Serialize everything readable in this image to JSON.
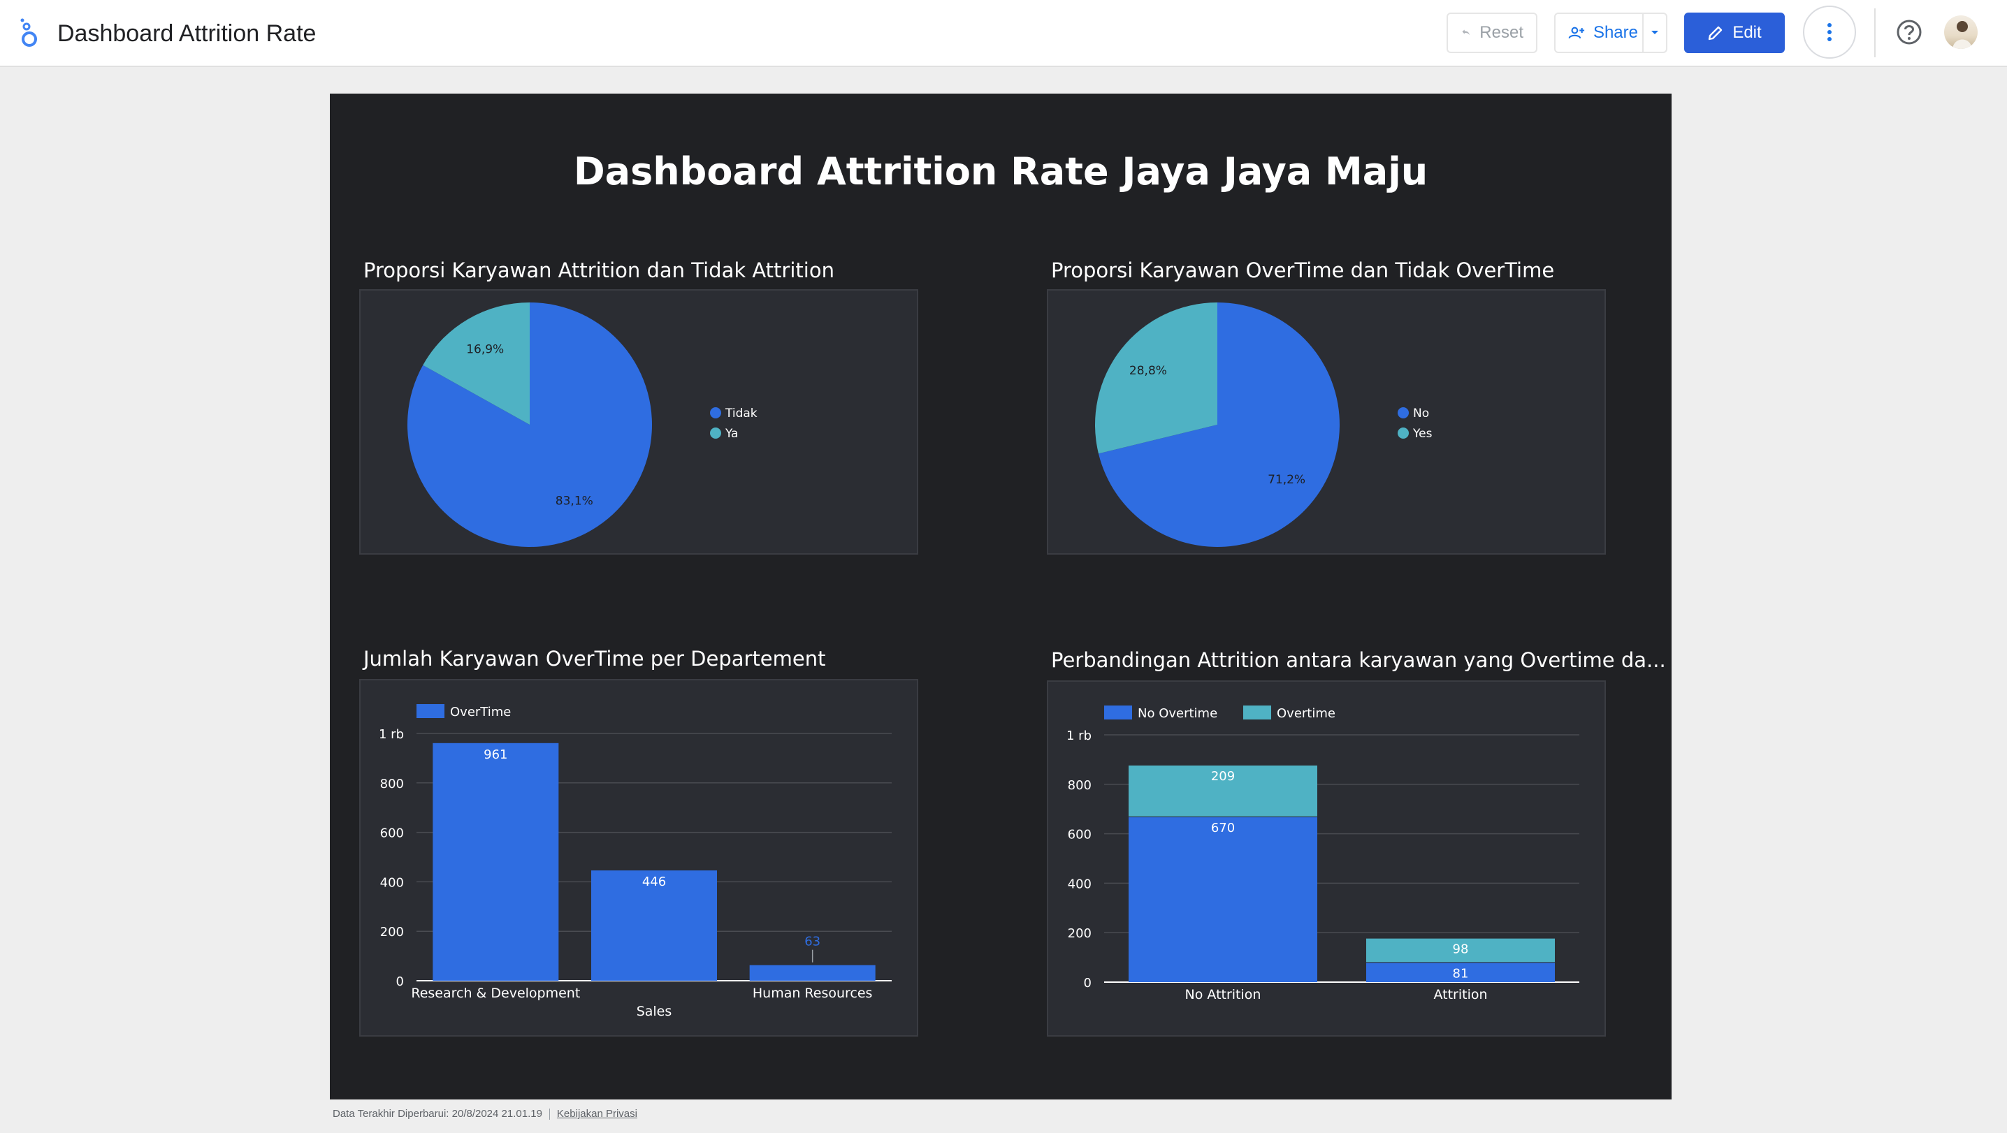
{
  "app": {
    "title": "Dashboard Attrition Rate"
  },
  "toolbar": {
    "reset_label": "Reset",
    "share_label": "Share",
    "edit_label": "Edit"
  },
  "report": {
    "title": "Dashboard Attrition Rate Jaya Jaya Maju"
  },
  "colors": {
    "primary": "#2f6de1",
    "secondary": "#4fb2c4",
    "canvas": "#202124",
    "panel": "#2b2d33",
    "edit_button": "#2b5fd9"
  },
  "footer": {
    "last_updated": "Data Terakhir Diperbarui: 20/8/2024 21.01.19",
    "privacy": "Kebijakan Privasi"
  },
  "panels": {
    "attrition_pie": {
      "title": "Proporsi Karyawan Attrition dan Tidak Attrition"
    },
    "overtime_pie": {
      "title": "Proporsi Karyawan OverTime dan Tidak OverTime"
    },
    "overtime_dept": {
      "title": "Jumlah Karyawan OverTime per Departement"
    },
    "attrition_compare": {
      "title": "Perbandingan Attrition antara karyawan yang Overtime da..."
    }
  },
  "chart_data": [
    {
      "type": "pie",
      "title": "Proporsi Karyawan Attrition dan Tidak Attrition",
      "slices": [
        {
          "label": "Tidak",
          "value": 83.1,
          "display": "83,1%",
          "color": "#2f6de1"
        },
        {
          "label": "Ya",
          "value": 16.9,
          "display": "16,9%",
          "color": "#4fb2c4"
        }
      ],
      "legend": "right"
    },
    {
      "type": "pie",
      "title": "Proporsi Karyawan OverTime dan Tidak OverTime",
      "slices": [
        {
          "label": "No",
          "value": 71.2,
          "display": "71,2%",
          "color": "#2f6de1"
        },
        {
          "label": "Yes",
          "value": 28.8,
          "display": "28,8%",
          "color": "#4fb2c4"
        }
      ],
      "legend": "right"
    },
    {
      "type": "bar",
      "title": "Jumlah Karyawan OverTime per Departement",
      "categories": [
        "Research & Development",
        "Sales",
        "Human Resources"
      ],
      "series": [
        {
          "name": "OverTime",
          "values": [
            961,
            446,
            63
          ],
          "color": "#2f6de1"
        }
      ],
      "ylim": [
        0,
        1000
      ],
      "yticks": [
        0,
        200,
        400,
        600,
        800,
        1000
      ],
      "ytick_labels": [
        "0",
        "200",
        "400",
        "600",
        "800",
        "1 rb"
      ],
      "xlabel": "",
      "grid": true,
      "legend": "top-left"
    },
    {
      "type": "bar",
      "stacked": true,
      "title": "Perbandingan Attrition antara karyawan yang Overtime da...",
      "categories": [
        "No Attrition",
        "Attrition"
      ],
      "series": [
        {
          "name": "No Overtime",
          "values": [
            670,
            81
          ],
          "color": "#2f6de1"
        },
        {
          "name": "Overtime",
          "values": [
            209,
            98
          ],
          "color": "#4fb2c4"
        }
      ],
      "ylim": [
        0,
        1000
      ],
      "yticks": [
        0,
        200,
        400,
        600,
        800,
        1000
      ],
      "ytick_labels": [
        "0",
        "200",
        "400",
        "600",
        "800",
        "1 rb"
      ],
      "grid": true,
      "legend": "top-left"
    }
  ]
}
